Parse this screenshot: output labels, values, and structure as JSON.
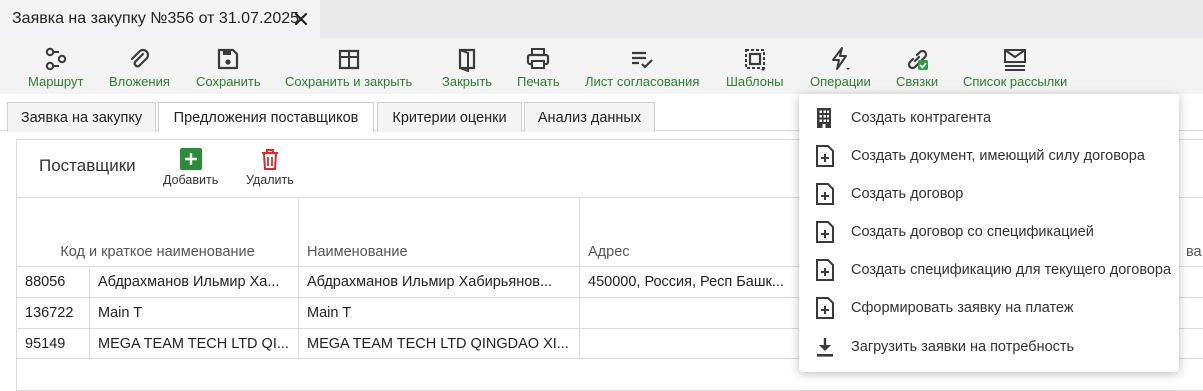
{
  "window": {
    "title": "Заявка на закупку №356 от 31.07.2025"
  },
  "toolbar": {
    "route": "Маршрут",
    "attachments": "Вложения",
    "save": "Сохранить",
    "save_close": "Сохранить и закрыть",
    "close": "Закрыть",
    "print": "Печать",
    "approval_sheet": "Лист согласования",
    "templates": "Шаблоны",
    "operations": "Операции",
    "links": "Связки",
    "mailing_list": "Список рассылки"
  },
  "tabs": [
    "Заявка на закупку",
    "Предложения поставщиков",
    "Критерии оценки",
    "Анализ данных"
  ],
  "suppliers": {
    "title": "Поставщики",
    "add": "Добавить",
    "delete": "Удалить"
  },
  "table": {
    "headers": [
      "Код и краткое наименование",
      "Наименование",
      "Адрес",
      "ва"
    ],
    "rows": [
      {
        "code": "88056",
        "short": "Абдрахманов Ильмир Ха...",
        "name": "Абдрахманов Ильмир Хабирьянов...",
        "address": "450000, Россия, Респ Башк..."
      },
      {
        "code": "136722",
        "short": "Main T",
        "name": "Main T",
        "address": ""
      },
      {
        "code": "95149",
        "short": "MEGA TEAM TECH LTD QI...",
        "name": "MEGA TEAM TECH LTD QINGDAO XI...",
        "address": ""
      }
    ]
  },
  "menu": {
    "items": [
      "Создать контрагента",
      "Создать документ, имеющий силу договора",
      "Создать договор",
      "Создать договор со спецификацией",
      "Создать спецификацию для текущего договора",
      "Сформировать заявку на платеж",
      "Загрузить заявки на потребность"
    ]
  },
  "colors": {
    "accent_green": "#2f7d32",
    "add_green": "#2e8b3a",
    "delete_red": "#d32f2f",
    "icon_dark": "#3a3a3a"
  }
}
